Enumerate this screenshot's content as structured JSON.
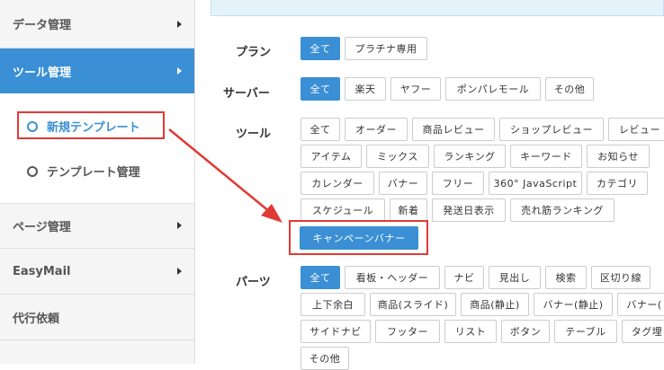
{
  "sidebar": {
    "items": [
      {
        "label": "データ管理"
      },
      {
        "label": "ツール管理"
      },
      {
        "label": "ページ管理"
      },
      {
        "label": "EasyMail"
      },
      {
        "label": "代行依頼"
      }
    ],
    "submenu": [
      {
        "label": "新規テンプレート"
      },
      {
        "label": "テンプレート管理"
      }
    ]
  },
  "filters": {
    "plan": {
      "label": "プラン",
      "options": [
        "全て",
        "プラチナ専用"
      ]
    },
    "server": {
      "label": "サーバー",
      "options": [
        "全て",
        "楽天",
        "ヤフー",
        "ポンパレモール",
        "その他"
      ]
    },
    "tool": {
      "label": "ツール",
      "options": [
        "全て",
        "オーダー",
        "商品レビュー",
        "ショップレビュー",
        "レビュー",
        "アイテム",
        "ミックス",
        "ランキング",
        "キーワード",
        "お知らせ",
        "カレンダー",
        "バナー",
        "フリー",
        "360° JavaScript",
        "カテゴリ",
        "スケジュール",
        "新着",
        "発送日表示",
        "売れ筋ランキング",
        "キャンペーンバナー"
      ]
    },
    "parts": {
      "label": "パーツ",
      "options": [
        "全て",
        "看板・ヘッダー",
        "ナビ",
        "見出し",
        "検索",
        "区切り線",
        "上下余白",
        "商品(スライド)",
        "商品(静止)",
        "バナー(静止)",
        "バナー(",
        "サイドナビ",
        "フッター",
        "リスト",
        "ボタン",
        "テーブル",
        "タグ埋",
        "その他"
      ]
    }
  },
  "colors": {
    "accent": "#3b8fd4",
    "highlight": "#e03a35",
    "sidebar_bg": "#f5f5f5"
  }
}
